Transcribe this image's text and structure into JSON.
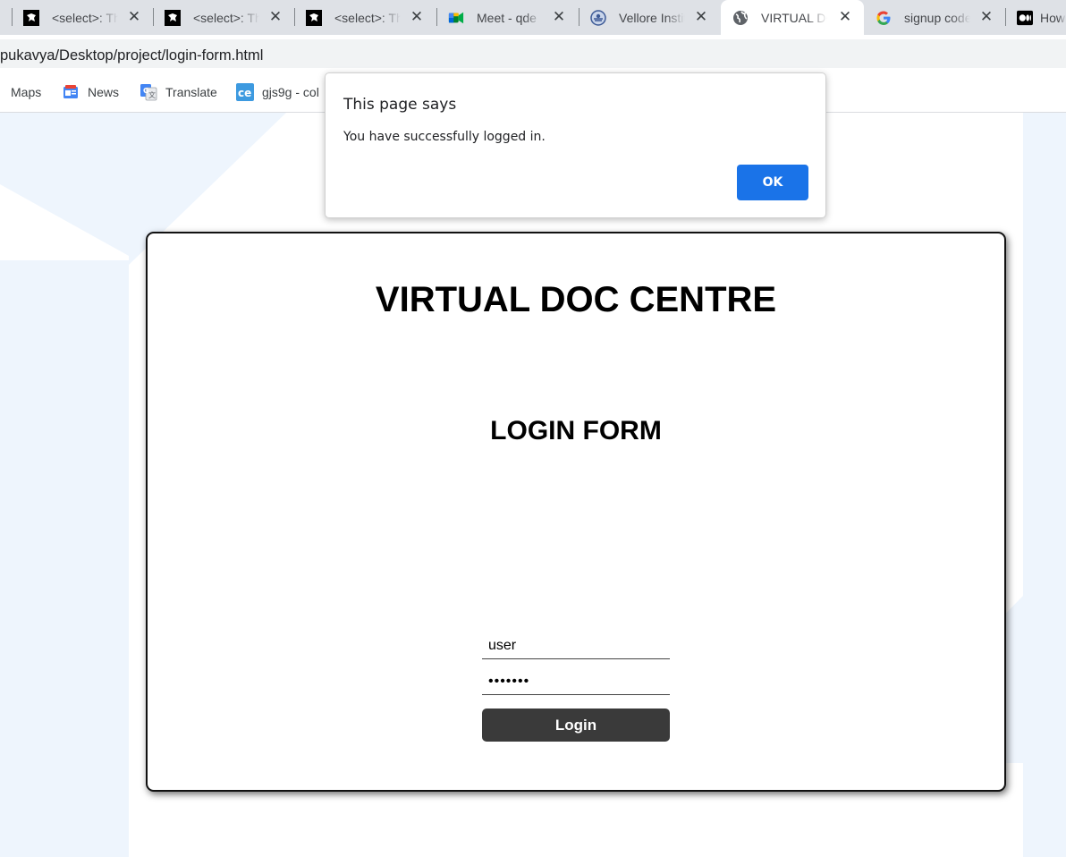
{
  "tabs": [
    {
      "title": "<select>: The HTML Select element",
      "icon": "mdn-dino-icon",
      "active": false
    },
    {
      "title": "<select>: The HTML Select element",
      "icon": "mdn-dino-icon",
      "active": false
    },
    {
      "title": "<select>: The HTML Select element",
      "icon": "mdn-dino-icon",
      "active": false
    },
    {
      "title": "Meet - qde",
      "icon": "google-meet-icon",
      "active": false
    },
    {
      "title": "Vellore Institute",
      "icon": "vit-logo-icon",
      "active": false
    },
    {
      "title": "VIRTUAL DOC CENTRE",
      "icon": "globe-icon",
      "active": true
    },
    {
      "title": "signup code",
      "icon": "google-g-icon",
      "active": false
    },
    {
      "title": "How",
      "icon": "medium-icon",
      "active": false
    }
  ],
  "address": {
    "url": "pukavya/Desktop/project/login-form.html"
  },
  "bookmarks": [
    {
      "label": "Maps",
      "icon": "maps-icon"
    },
    {
      "label": "News",
      "icon": "news-icon"
    },
    {
      "label": "Translate",
      "icon": "translate-icon"
    },
    {
      "label": "gjs9g - col",
      "icon": "ce-icon"
    }
  ],
  "page": {
    "site_title": "VIRTUAL DOC CENTRE",
    "form_title": "LOGIN FORM",
    "username_value": "user",
    "password_value": "•••••••",
    "login_label": "Login"
  },
  "dialog": {
    "title": "This page says",
    "message": "You have successfully logged in.",
    "ok_label": "OK"
  },
  "colors": {
    "accent": "#1a73e8",
    "login_button": "#3a3a3a",
    "page_background": "#eef5fd"
  }
}
